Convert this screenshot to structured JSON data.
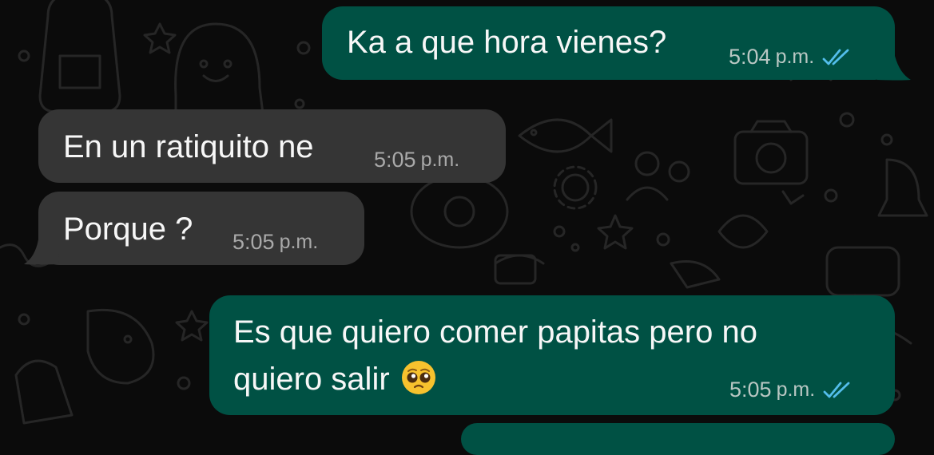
{
  "chat": {
    "messages": [
      {
        "direction": "outgoing",
        "text": "Ka a que hora vienes?",
        "time": "5:04",
        "suffix": "p.m.",
        "status": "read-double-check-icon"
      },
      {
        "direction": "incoming",
        "text": "En un ratiquito ne",
        "time": "5:05",
        "suffix": "p.m."
      },
      {
        "direction": "incoming",
        "text": "Porque ?",
        "time": "5:05",
        "suffix": "p.m."
      },
      {
        "direction": "outgoing",
        "line1": "Es que quiero comer papitas pero no",
        "line2": "quiero salir",
        "emoji": "pleading-face-emoji",
        "time": "5:05",
        "suffix": "p.m.",
        "status": "read-double-check-icon"
      }
    ]
  },
  "colors": {
    "background": "#0b0b0b",
    "outgoing_bubble": "#005144",
    "incoming_bubble": "#353535",
    "read_ticks": "#53bdeb",
    "doodle": "#262626"
  }
}
